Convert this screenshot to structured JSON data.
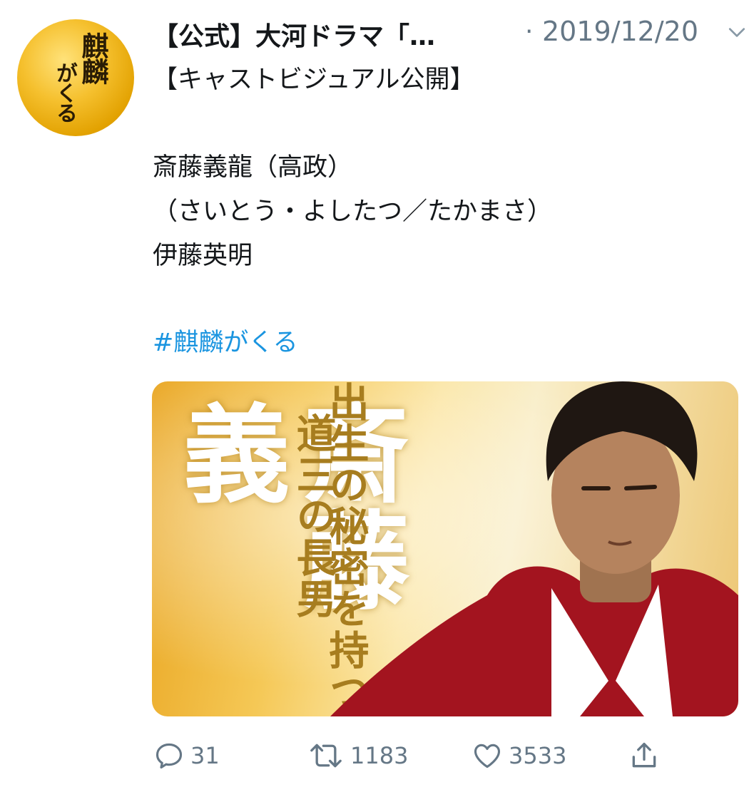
{
  "tweet": {
    "author_name": "【公式】大河ドラマ「…",
    "separator": "·",
    "date": "2019/12/20",
    "text_lines": [
      "【キャストビジュアル公開】",
      "斎藤義龍（高政）",
      "（さいとう・よしたつ／たかまさ）",
      "伊藤英明"
    ],
    "hashtag": "#麒麟がくる",
    "avatar_text": {
      "line1": "麒麟",
      "line2": "がくる"
    },
    "media": {
      "big_text": "斎藤義",
      "vertical_text_1": "出生の秘密を持つ",
      "vertical_text_2": "道三の長男"
    },
    "actions": {
      "reply_count": "31",
      "retweet_count": "1183",
      "like_count": "3533"
    }
  },
  "icons": [
    "chevron-down-icon",
    "reply-icon",
    "retweet-icon",
    "like-icon",
    "share-icon"
  ],
  "colors": {
    "link": "#1b95e0",
    "muted": "#657786",
    "text": "#14171a"
  }
}
